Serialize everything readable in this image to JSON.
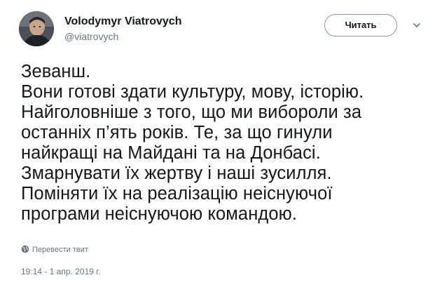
{
  "author": {
    "display_name": "Volodymyr Viatrovych",
    "handle": "@viatrovych",
    "avatar_icon": "profile-photo"
  },
  "follow_button": {
    "label": "Читать"
  },
  "menu": {
    "icon": "chevron-down-icon"
  },
  "tweet": {
    "lines": [
      "Зеванш.",
      "Вони готові здати культуру, мову, історію.",
      "Найголовніше з того, що ми вибороли за",
      "останніх п’ять років. Те, за що гинули",
      "найкращі на Майдані та на Донбасі.",
      "Змарнувати їх жертву і наші зусилля.",
      "Поміняти їх на реалізацію неіснуючої",
      "програми неіснуючою командою."
    ]
  },
  "translate": {
    "label": "Перевести твит",
    "icon": "globe-icon"
  },
  "timestamp": "19:14 - 1 апр. 2019 г.",
  "colors": {
    "text": "#14171a",
    "secondary": "#657786",
    "border": "#8899a6"
  }
}
